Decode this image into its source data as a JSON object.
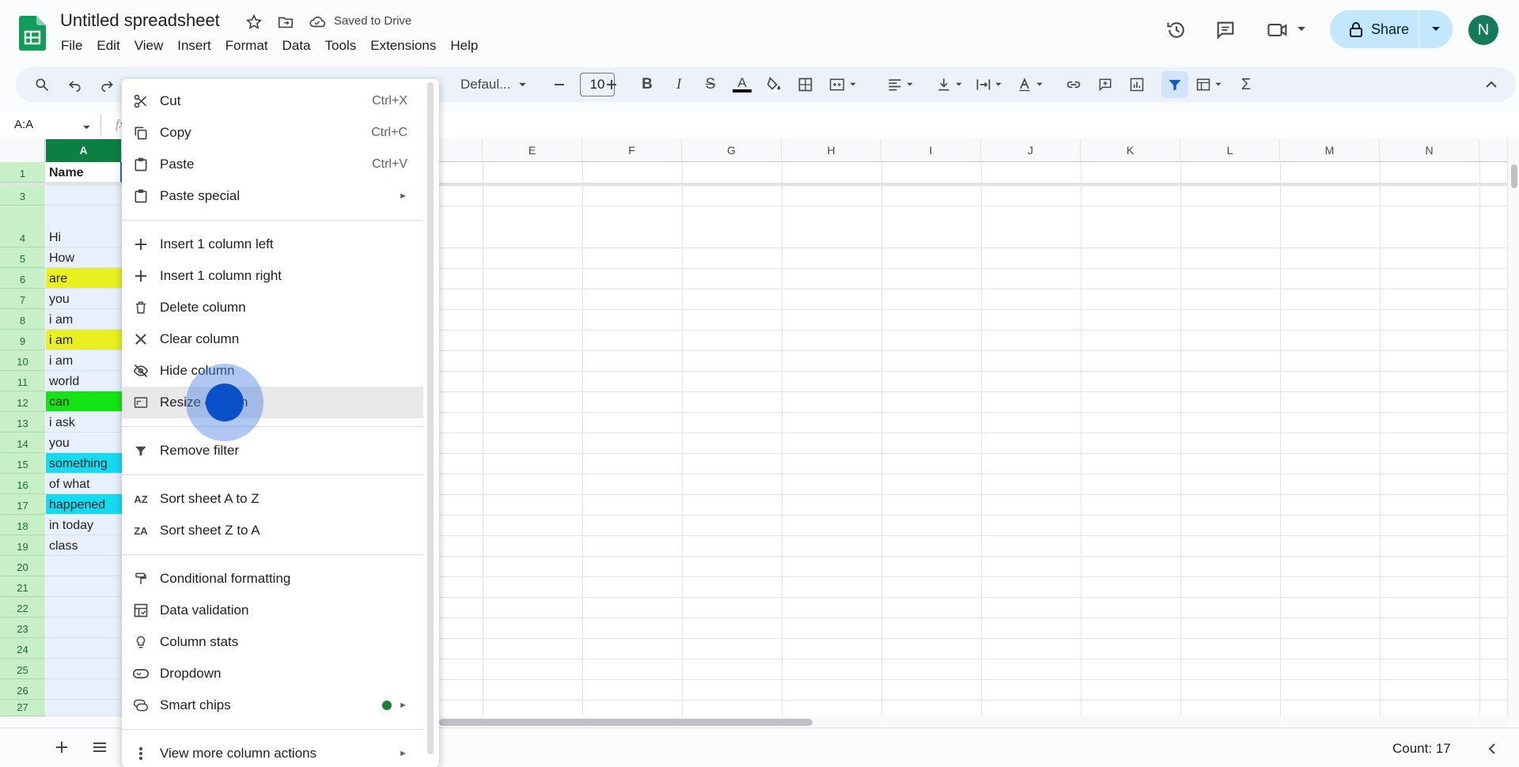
{
  "title": "Untitled spreadsheet",
  "save_status": "Saved to Drive",
  "menu": [
    "File",
    "Edit",
    "View",
    "Insert",
    "Format",
    "Data",
    "Tools",
    "Extensions",
    "Help"
  ],
  "share_label": "Share",
  "avatar_initial": "N",
  "toolbar": {
    "font": "Defaul...",
    "font_size": "10"
  },
  "name_box": "A:A",
  "columns": [
    "A",
    "E",
    "F",
    "G",
    "H",
    "I",
    "J",
    "K",
    "L",
    "M",
    "N"
  ],
  "rows": [
    {
      "num": "1",
      "value": "Name"
    },
    {
      "num": "3",
      "value": ""
    },
    {
      "num": "4",
      "value": "Hi"
    },
    {
      "num": "5",
      "value": "How"
    },
    {
      "num": "6",
      "value": "are"
    },
    {
      "num": "7",
      "value": "you"
    },
    {
      "num": "8",
      "value": "i am"
    },
    {
      "num": "9",
      "value": "i am"
    },
    {
      "num": "10",
      "value": "i am"
    },
    {
      "num": "11",
      "value": "world"
    },
    {
      "num": "12",
      "value": "can"
    },
    {
      "num": "13",
      "value": "i ask"
    },
    {
      "num": "14",
      "value": "you"
    },
    {
      "num": "15",
      "value": "something"
    },
    {
      "num": "16",
      "value": "of what"
    },
    {
      "num": "17",
      "value": "happened"
    },
    {
      "num": "18",
      "value": "in today"
    },
    {
      "num": "19",
      "value": "class"
    },
    {
      "num": "20",
      "value": ""
    },
    {
      "num": "21",
      "value": ""
    },
    {
      "num": "22",
      "value": ""
    },
    {
      "num": "23",
      "value": ""
    },
    {
      "num": "24",
      "value": ""
    },
    {
      "num": "25",
      "value": ""
    },
    {
      "num": "26",
      "value": ""
    },
    {
      "num": "27",
      "value": ""
    }
  ],
  "context_menu": {
    "items": [
      {
        "label": "Cut",
        "shortcut": "Ctrl+X"
      },
      {
        "label": "Copy",
        "shortcut": "Ctrl+C"
      },
      {
        "label": "Paste",
        "shortcut": "Ctrl+V"
      },
      {
        "label": "Paste special",
        "shortcut": ""
      },
      {
        "label": "Insert 1 column left",
        "shortcut": ""
      },
      {
        "label": "Insert 1 column right",
        "shortcut": ""
      },
      {
        "label": "Delete column",
        "shortcut": ""
      },
      {
        "label": "Clear column",
        "shortcut": ""
      },
      {
        "label": "Hide column",
        "shortcut": ""
      },
      {
        "label": "Resize column",
        "shortcut": ""
      },
      {
        "label": "Remove filter",
        "shortcut": ""
      },
      {
        "label": "Sort sheet A to Z",
        "shortcut": ""
      },
      {
        "label": "Sort sheet Z to A",
        "shortcut": ""
      },
      {
        "label": "Conditional formatting",
        "shortcut": ""
      },
      {
        "label": "Data validation",
        "shortcut": ""
      },
      {
        "label": "Column stats",
        "shortcut": ""
      },
      {
        "label": "Dropdown",
        "shortcut": ""
      },
      {
        "label": "Smart chips",
        "shortcut": ""
      },
      {
        "label": "View more column actions",
        "shortcut": ""
      }
    ]
  },
  "status": {
    "count": "Count: 17"
  },
  "colors": {
    "selected_header": "#0b8043",
    "yellow": "#e8f020",
    "green": "#14e414",
    "cyan": "#14dcf0",
    "share_bg": "#c2e7ff"
  }
}
